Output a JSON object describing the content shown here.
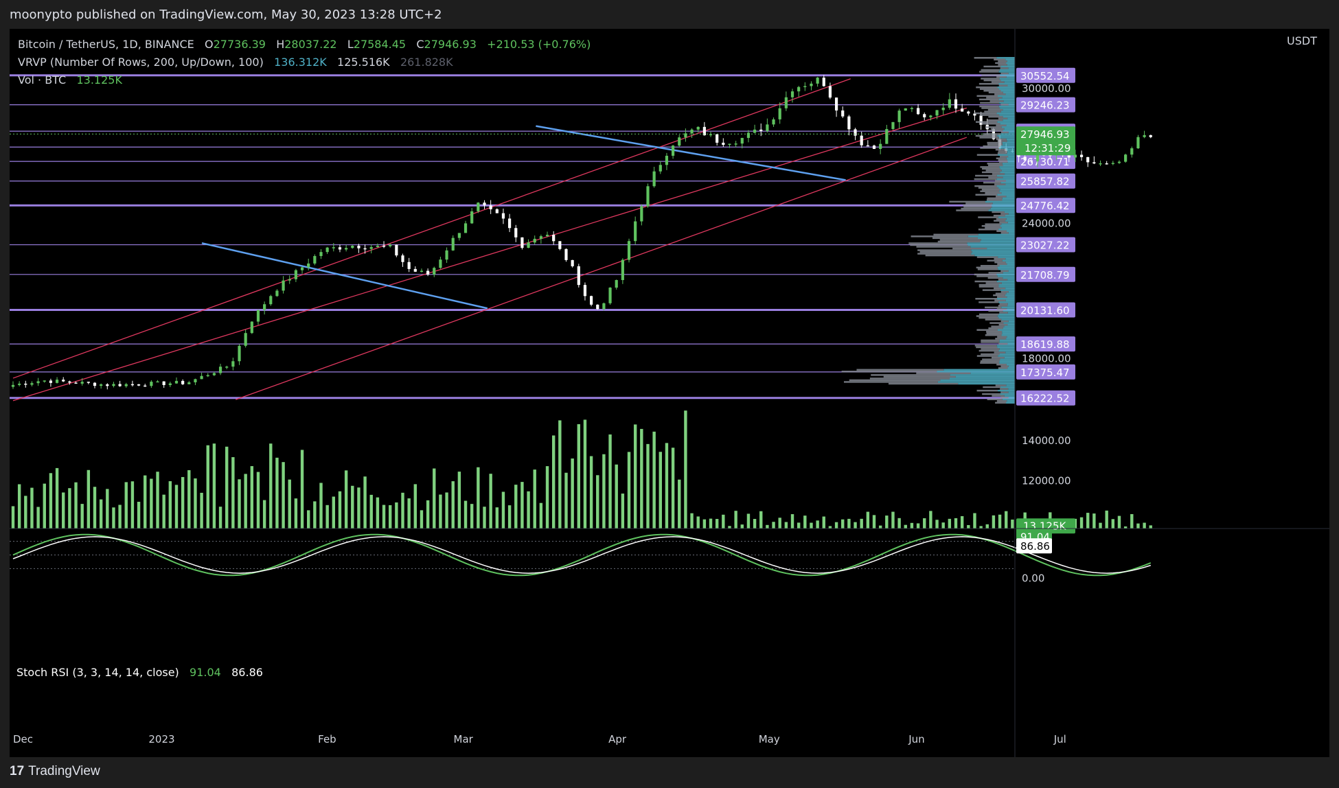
{
  "header": {
    "publish_line": "moonypto published on TradingView.com, May 30, 2023 13:28 UTC+2"
  },
  "legend": {
    "symbol": "Bitcoin / TetherUS, 1D, BINANCE",
    "open_label": "O",
    "open": "27736.39",
    "high_label": "H",
    "high": "28037.22",
    "low_label": "L",
    "low": "27584.45",
    "close_label": "C",
    "close": "27946.93",
    "change": "+210.53 (+0.76%)",
    "vrvp_label": "VRVP (Number Of Rows, 200, Up/Down, 100)",
    "vrvp_up": "136.312K",
    "vrvp_down": "125.516K",
    "vrvp_total": "261.828K",
    "vol_label": "Vol · BTC",
    "vol_value": "13.125K"
  },
  "stoch_legend": {
    "label": "Stoch RSI (3, 3, 14, 14, close)",
    "k": "91.04",
    "d": "86.86"
  },
  "currency": "USDT",
  "footer": {
    "brand": "TradingView",
    "logo_mark": "17"
  },
  "colors": {
    "background": "#000000",
    "up": "#5fc25f",
    "down": "#ffffff",
    "level_line": "#9a7fe0",
    "channel": "#e0385f",
    "trendline": "#5ea0ef",
    "volume": "#7fd17f",
    "vp_up": "#4fb0c6",
    "vp_down": "#8a8e99",
    "label_bg": "#9a7fe0"
  },
  "chart_data": {
    "type": "candlestick",
    "title": "Bitcoin / TetherUS, 1D, BINANCE",
    "x_start": "2022-11-30",
    "x_ticks": [
      "Dec",
      "2023",
      "Feb",
      "Mar",
      "Apr",
      "May",
      "Jun",
      "Jul"
    ],
    "y_axis_ticks": [
      "18000.00",
      "24000.00",
      "30000.00"
    ],
    "ylim": [
      16000,
      31400
    ],
    "horizontal_levels": [
      {
        "value": 30552.54,
        "label": "30552.54",
        "weight": "thick"
      },
      {
        "value": 29246.23,
        "label": "29246.23",
        "weight": "thin"
      },
      {
        "value": 28072.28,
        "label": "28072.28",
        "weight": "thin"
      },
      {
        "value": 27366.94,
        "label": "27366.94",
        "weight": "thin"
      },
      {
        "value": 26730.71,
        "label": "26730.71",
        "weight": "thin"
      },
      {
        "value": 25857.82,
        "label": "25857.82",
        "weight": "thin"
      },
      {
        "value": 24776.42,
        "label": "24776.42",
        "weight": "thick"
      },
      {
        "value": 23027.22,
        "label": "23027.22",
        "weight": "thin"
      },
      {
        "value": 21708.79,
        "label": "21708.79",
        "weight": "thin"
      },
      {
        "value": 20131.6,
        "label": "20131.60",
        "weight": "thick"
      },
      {
        "value": 18619.88,
        "label": "18619.88",
        "weight": "thin"
      },
      {
        "value": 17375.47,
        "label": "17375.47",
        "weight": "thin"
      },
      {
        "value": 16222.52,
        "label": "16222.52",
        "weight": "thick"
      }
    ],
    "last_price": {
      "value": 27946.93,
      "label": "27946.93",
      "countdown": "12:31:29"
    },
    "channel_lines": [
      {
        "from": {
          "day": 0,
          "price": 17100
        },
        "to": {
          "day": 173,
          "price": 30400
        }
      },
      {
        "from": {
          "day": 0,
          "price": 16100
        },
        "to": {
          "day": 197,
          "price": 29100
        }
      },
      {
        "from": {
          "day": 46,
          "price": 16150
        },
        "to": {
          "day": 197,
          "price": 27800
        }
      }
    ],
    "trendlines": [
      {
        "from": {
          "day": 39,
          "price": 23100
        },
        "to": {
          "day": 98,
          "price": 20200
        }
      },
      {
        "from": {
          "day": 108,
          "price": 28300
        },
        "to": {
          "day": 172,
          "price": 25900
        }
      }
    ],
    "volume": {
      "y_ticks": [
        "12000.00",
        "14000.00"
      ],
      "ylim": [
        9600,
        16000
      ],
      "last_label": "13.125K"
    },
    "stoch_rsi": {
      "y_ticks": [
        "0.00"
      ],
      "ylim": [
        -8,
        108
      ],
      "bands": [
        80,
        50,
        20
      ],
      "k_last": "91.04",
      "d_last": "86.86"
    }
  }
}
